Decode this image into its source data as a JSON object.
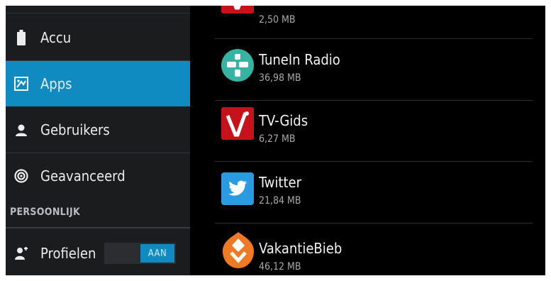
{
  "sidebar": {
    "items": [
      {
        "label": "Accu",
        "icon": "battery-icon"
      },
      {
        "label": "Apps",
        "icon": "apps-icon",
        "selected": true
      },
      {
        "label": "Gebruikers",
        "icon": "user-icon"
      },
      {
        "label": "Geavanceerd",
        "icon": "target-icon"
      }
    ],
    "section_header": "PERSOONLIJK",
    "profielen": {
      "label": "Profielen",
      "icon": "profiles-icon",
      "toggle_label": "AAN"
    }
  },
  "apps": [
    {
      "name": "",
      "size": "2,50 MB",
      "icon": "tv-gids-icon"
    },
    {
      "name": "TuneIn Radio",
      "size": "36,98 MB",
      "icon": "tunein-radio-icon"
    },
    {
      "name": "TV-Gids",
      "size": "6,27 MB",
      "icon": "tv-gids-icon"
    },
    {
      "name": "Twitter",
      "size": "21,84 MB",
      "icon": "twitter-icon"
    },
    {
      "name": "VakantieBieb",
      "size": "46,12 MB",
      "icon": "vakantiebieb-icon"
    }
  ],
  "colors": {
    "accent": "#0f8bc2",
    "sidebar_bg": "#1b1c1e",
    "list_bg": "#000000"
  }
}
